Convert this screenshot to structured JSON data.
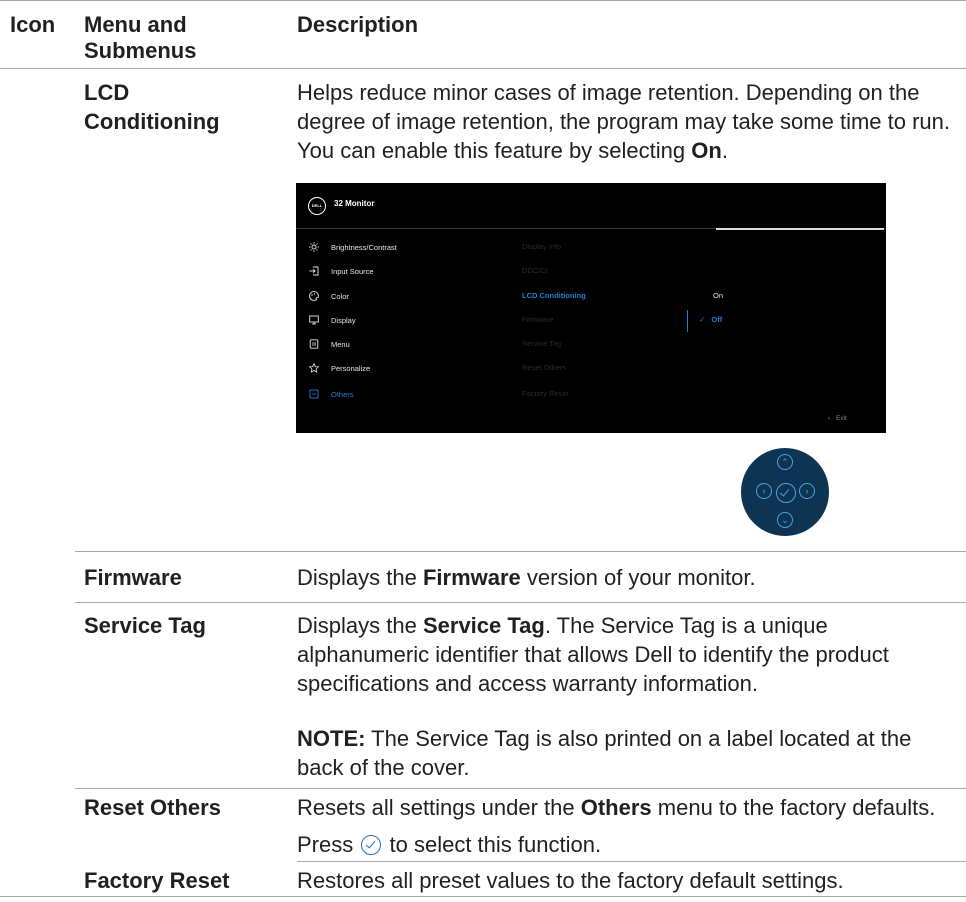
{
  "headers": {
    "icon": "Icon",
    "menu": "Menu and Submenus",
    "description": "Description"
  },
  "rows": {
    "lcd": {
      "menu": "LCD Conditioning",
      "desc_text": "Helps reduce minor cases of image retention. Depending on the degree of image retention, the program may take some time to run. You can enable this feature by selecting",
      "desc_bold": "On",
      "desc_end": "."
    },
    "firmware": {
      "menu": "Firmware",
      "desc_pre": "Displays the",
      "desc_bold": "Firmware",
      "desc_post": "version of your monitor."
    },
    "service_tag": {
      "menu": "Service Tag",
      "desc_pre": "Displays the",
      "desc_bold": "Service Tag",
      "desc_post": ". The Service Tag is a unique alphanumeric identifier that allows Dell to identify the product specifications and access warranty information.",
      "note_label": "NOTE:",
      "note_text": "The Service Tag is also printed on a label located at the back of the cover."
    },
    "reset_others": {
      "menu": "Reset Others",
      "desc_pre": "Resets all settings under the",
      "desc_bold": "Others",
      "desc_post": "menu to the factory defaults.",
      "press_pre": "Press",
      "press_post": "to select this function."
    },
    "factory_reset": {
      "menu": "Factory Reset",
      "desc": "Restores all preset values to the factory default settings."
    }
  },
  "osd": {
    "logo": "DELL",
    "title": "32 Monitor",
    "menu_items": [
      {
        "label": "Brightness/Contrast",
        "icon": "brightness-icon"
      },
      {
        "label": "Input Source",
        "icon": "input-source-icon"
      },
      {
        "label": "Color",
        "icon": "color-icon"
      },
      {
        "label": "Display",
        "icon": "display-icon"
      },
      {
        "label": "Menu",
        "icon": "menu-icon"
      },
      {
        "label": "Personalize",
        "icon": "star-icon"
      },
      {
        "label": "Others",
        "icon": "others-icon"
      }
    ],
    "submenu_items": [
      "Display Info",
      "DDC/CI",
      "LCD Conditioning",
      "Firmware",
      "Service Tag",
      "Reset Others",
      "Factory Reset"
    ],
    "options": [
      "On",
      "Off"
    ],
    "exit": "Exit",
    "accent": "#1e7fd6"
  }
}
